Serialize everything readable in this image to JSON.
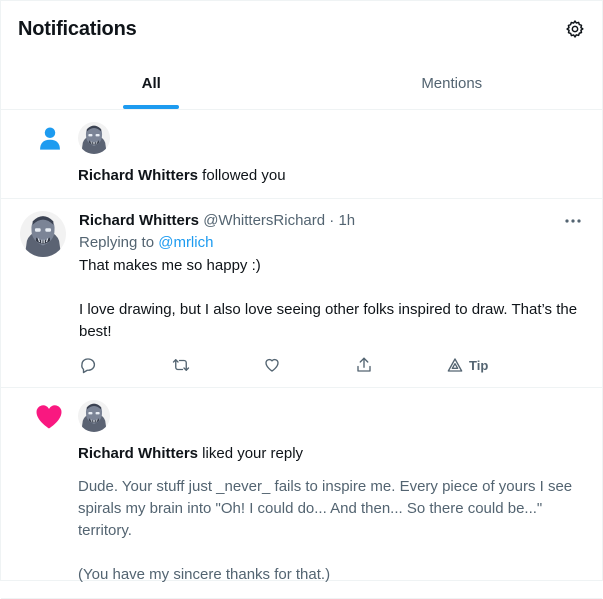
{
  "header": {
    "title": "Notifications",
    "settings_icon": "gear-icon"
  },
  "tabs": [
    {
      "label": "All",
      "active": true
    },
    {
      "label": "Mentions",
      "active": false
    }
  ],
  "notifications": [
    {
      "type": "follow",
      "icon": "person-icon",
      "icon_color": "#1d9bf0",
      "user_name": "Richard Whitters",
      "action_text": " followed you"
    },
    {
      "type": "reply",
      "user_name": "Richard Whitters",
      "handle": "@WhittersRichard",
      "separator": "·",
      "time": "1h",
      "replying_prefix": "Replying to ",
      "replying_to": "@mrlich",
      "text": "That makes me so happy :)\n\nI love drawing, but I also love seeing other folks inspired to draw. That’s the best!",
      "actions": {
        "tip_label": "Tip"
      }
    },
    {
      "type": "like",
      "icon": "heart-icon",
      "icon_color": "#f91880",
      "user_name": "Richard Whitters",
      "action_text": " liked your reply",
      "quoted_text": "Dude. Your stuff just _never_ fails to inspire me. Every piece of yours I see spirals my brain into \"Oh! I could do... And then... So there could be...\" territory.\n\n(You have my sincere thanks for that.)"
    }
  ],
  "colors": {
    "accent": "#1d9bf0",
    "like": "#f91880",
    "secondary_text": "#536471"
  }
}
